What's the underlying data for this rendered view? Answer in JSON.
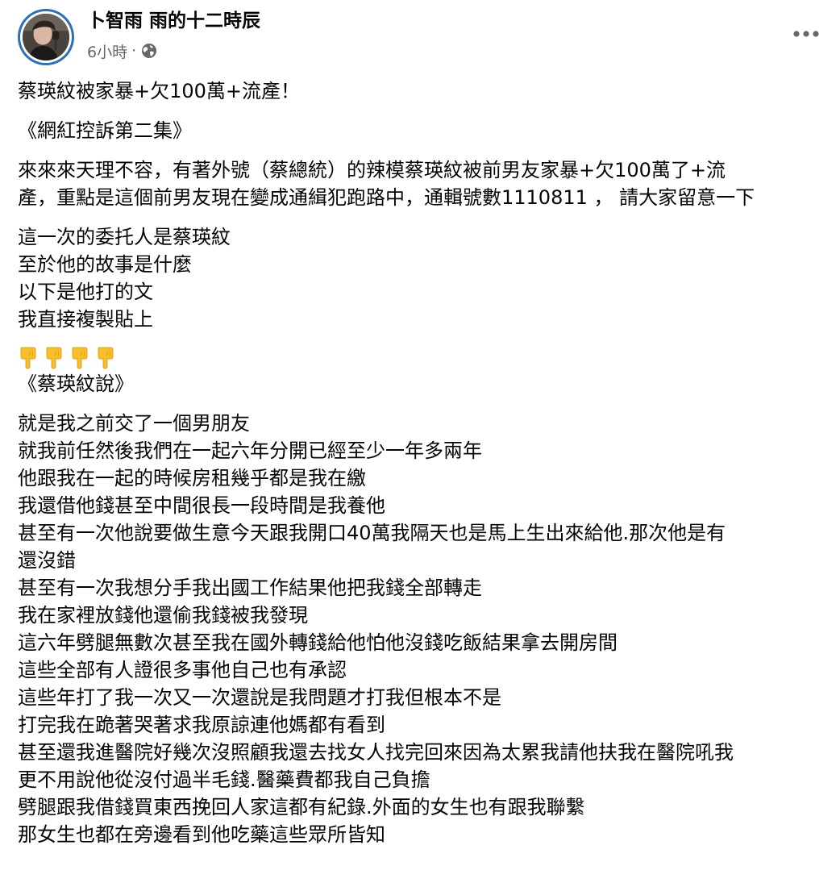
{
  "post": {
    "author": "卜智雨 雨的十二時辰",
    "time": "6小時",
    "separator": "·",
    "audience_icon": "globe-icon",
    "more_icon": "more-options-icon",
    "colors": {
      "text": "#050505",
      "meta": "#65676b",
      "avatar_ring": "#2f6fb6"
    }
  },
  "body": {
    "headline": "蔡瑛紋被家暴+欠100萬+流產！",
    "series_title": "《網紅控訴第二集》",
    "intro_line_1": "來來來天理不容，有著外號（蔡總統）的辣模蔡瑛紋被前男友家暴+欠100萬了+流",
    "intro_line_2": "產，重點是這個前男友現在變成通緝犯跑路中，通輯號數1110811 ， 請大家留意一下",
    "client_lines": [
      "這一次的委托人是蔡瑛紋",
      "至於他的故事是什麼",
      "以下是他打的文",
      "我直接複製貼上"
    ],
    "emoji_icon": "pointing-down-hand-icon",
    "emoji_count": 4,
    "quote_title": "《蔡瑛紋說》",
    "story_lines": [
      "就是我之前交了一個男朋友",
      "就我前任然後我們在一起六年分開已經至少一年多兩年",
      "他跟我在一起的時候房租幾乎都是我在繳",
      "我還借他錢甚至中間很長一段時間是我養他",
      "甚至有一次他說要做生意今天跟我開口40萬我隔天也是馬上生出來給他.那次他是有",
      "還沒錯",
      "甚至有一次我想分手我出國工作結果他把我錢全部轉走",
      "我在家裡放錢他還偷我錢被我發現",
      "這六年劈腿無數次甚至我在國外轉錢給他怕他沒錢吃飯結果拿去開房間",
      "這些全部有人證很多事他自己也有承認",
      "這些年打了我一次又一次還說是我問題才打我但根本不是",
      "打完我在跪著哭著求我原諒連他媽都有看到",
      "甚至還我進醫院好幾次沒照顧我還去找女人找完回來因為太累我請他扶我在醫院吼我",
      "更不用說他從沒付過半毛錢.醫藥費都我自己負擔",
      "劈腿跟我借錢買東西挽回人家這都有紀錄.外面的女生也有跟我聯繫",
      "那女生也都在旁邊看到他吃藥這些眾所皆知"
    ]
  }
}
